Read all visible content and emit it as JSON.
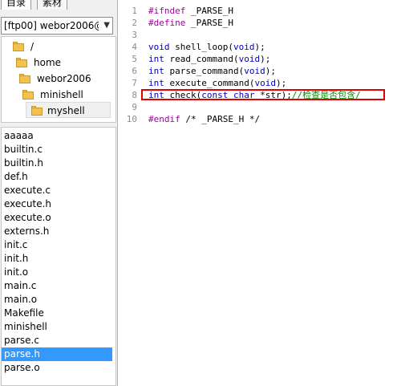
{
  "tabs": [
    {
      "label": "目录",
      "active": true
    },
    {
      "label": "素材",
      "active": false
    }
  ],
  "site_select": {
    "value": "[ftp00] webor2006@",
    "arrow": "▼"
  },
  "tree": [
    {
      "label": "/",
      "selected": false
    },
    {
      "label": "home",
      "selected": false
    },
    {
      "label": "webor2006",
      "selected": false
    },
    {
      "label": "minishell",
      "selected": false
    },
    {
      "label": "myshell",
      "selected": true
    }
  ],
  "files": [
    "aaaaa",
    "builtin.c",
    "builtin.h",
    "def.h",
    "execute.c",
    "execute.h",
    "execute.o",
    "externs.h",
    "init.c",
    "init.h",
    "init.o",
    "main.c",
    "main.o",
    "Makefile",
    "minishell",
    "parse.c",
    "parse.h",
    "parse.o"
  ],
  "selected_file": "parse.h",
  "editor": {
    "lines": [
      {
        "n": "1",
        "tokens": [
          [
            "pp",
            "#ifndef"
          ],
          [
            "pl",
            " _PARSE_H"
          ]
        ]
      },
      {
        "n": "2",
        "tokens": [
          [
            "pp",
            "#define"
          ],
          [
            "pl",
            " _PARSE_H"
          ]
        ]
      },
      {
        "n": "3",
        "tokens": []
      },
      {
        "n": "4",
        "tokens": [
          [
            "kw",
            "void"
          ],
          [
            "pl",
            " shell_loop("
          ],
          [
            "kw",
            "void"
          ],
          [
            "pl",
            ");"
          ]
        ]
      },
      {
        "n": "5",
        "tokens": [
          [
            "kw",
            "int"
          ],
          [
            "pl",
            " read_command("
          ],
          [
            "kw",
            "void"
          ],
          [
            "pl",
            ");"
          ]
        ]
      },
      {
        "n": "6",
        "tokens": [
          [
            "kw",
            "int"
          ],
          [
            "pl",
            " parse_command("
          ],
          [
            "kw",
            "void"
          ],
          [
            "pl",
            ");"
          ]
        ]
      },
      {
        "n": "7",
        "tokens": [
          [
            "kw",
            "int"
          ],
          [
            "pl",
            " execute_command("
          ],
          [
            "kw",
            "void"
          ],
          [
            "pl",
            ");"
          ]
        ]
      },
      {
        "n": "8",
        "tokens": [
          [
            "kw",
            "int"
          ],
          [
            "pl",
            " check("
          ],
          [
            "kw",
            "const char"
          ],
          [
            "pl",
            " *str);"
          ],
          [
            "cm",
            "//检查是否包含/"
          ]
        ]
      },
      {
        "n": "9",
        "tokens": []
      },
      {
        "n": "10",
        "tokens": [
          [
            "pp",
            "#endif"
          ],
          [
            "pl",
            " /* _PARSE_H */"
          ]
        ]
      }
    ],
    "highlighted_line": "8",
    "highlight_color": "#e00000"
  }
}
